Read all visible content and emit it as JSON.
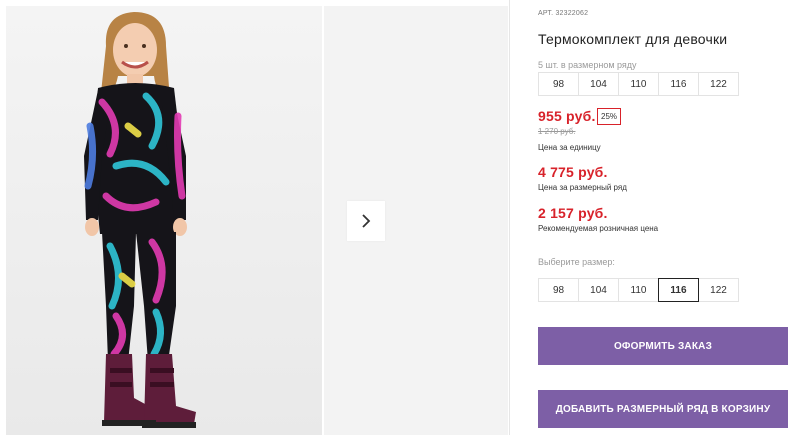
{
  "gallery": {
    "next_glyph": "›"
  },
  "product": {
    "article_label": "АРТ.",
    "article_number": "32322062",
    "title": "Термокомплект для девочки",
    "row_note": "5 шт. в размерном ряду",
    "row_sizes": [
      "98",
      "104",
      "110",
      "116",
      "122"
    ],
    "unit_price": "955 руб.",
    "discount": "25%",
    "old_price": "1 270 руб.",
    "unit_caption": "Цена за единицу",
    "row_price": "4 775 руб.",
    "row_caption": "Цена за размерный ряд",
    "retail_price": "2 157 руб.",
    "retail_caption": "Рекомендуемая розничная цена",
    "choose_label": "Выберите размер:",
    "choose_sizes": [
      "98",
      "104",
      "110",
      "116",
      "122"
    ],
    "selected_size": "116",
    "order_button": "ОФОРМИТЬ ЗАКАЗ",
    "add_row_button": "ДОБАВИТЬ РАЗМЕРНЫЙ РЯД В КОРЗИНУ"
  },
  "colors": {
    "accent_button": "#7d5fa6",
    "price_red": "#d8222a"
  }
}
